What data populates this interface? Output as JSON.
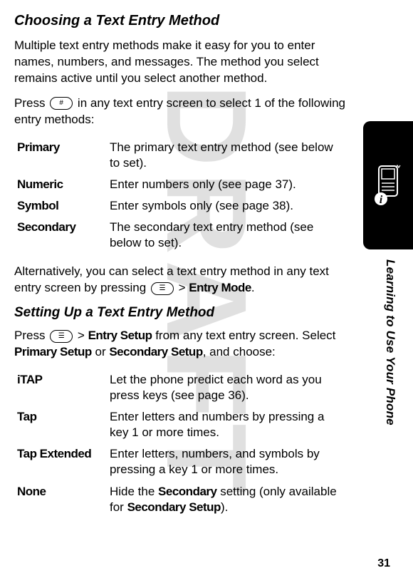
{
  "watermark": "DRAFT",
  "heading1": "Choosing a Text Entry Method",
  "intro": "Multiple text entry methods make it easy for you to enter names, numbers, and messages. The method you select remains active until you select another method.",
  "press_prefix": "Press ",
  "press_suffix": " in any text entry screen to select 1 of the following entry methods:",
  "key_hash": "#",
  "key_menu": "☰",
  "table1": {
    "r0": {
      "label": "Primary",
      "desc": "The primary text entry method (see below to set)."
    },
    "r1": {
      "label": "Numeric",
      "desc": "Enter numbers only (see page 37)."
    },
    "r2": {
      "label": "Symbol",
      "desc": "Enter symbols only (see page 38)."
    },
    "r3": {
      "label": "Secondary",
      "desc": "The secondary text entry method (see below to set)."
    }
  },
  "alt_prefix": "Alternatively, you can select a text entry method in any text entry screen by pressing ",
  "alt_gt": " > ",
  "alt_mode": "Entry Mode",
  "alt_period": ".",
  "heading2": "Setting Up a Text Entry Method",
  "setup_prefix": "Press ",
  "setup_gt": " > ",
  "setup_entry": "Entry Setup",
  "setup_mid": " from any text entry screen. Select ",
  "setup_primary": "Primary Setup",
  "setup_or": " or ",
  "setup_secondary": "Secondary Setup",
  "setup_end": ", and choose:",
  "table2": {
    "r0": {
      "label": "iTAP",
      "desc": "Let the phone predict each word as you press keys (see page 36)."
    },
    "r1": {
      "label": "Tap",
      "desc": "Enter letters and numbers by pressing a key 1 or more times."
    },
    "r2": {
      "label": "Tap Extended",
      "desc": "Enter letters, numbers, and symbols by pressing a key 1 or more times."
    },
    "r3": {
      "label": "None",
      "p1": "Hide the ",
      "b1": "Secondary",
      "p2": " setting (only available for ",
      "b2": "Secondary Setup",
      "p3": ")."
    }
  },
  "side_label": "Learning to Use Your Phone",
  "page_number": "31"
}
